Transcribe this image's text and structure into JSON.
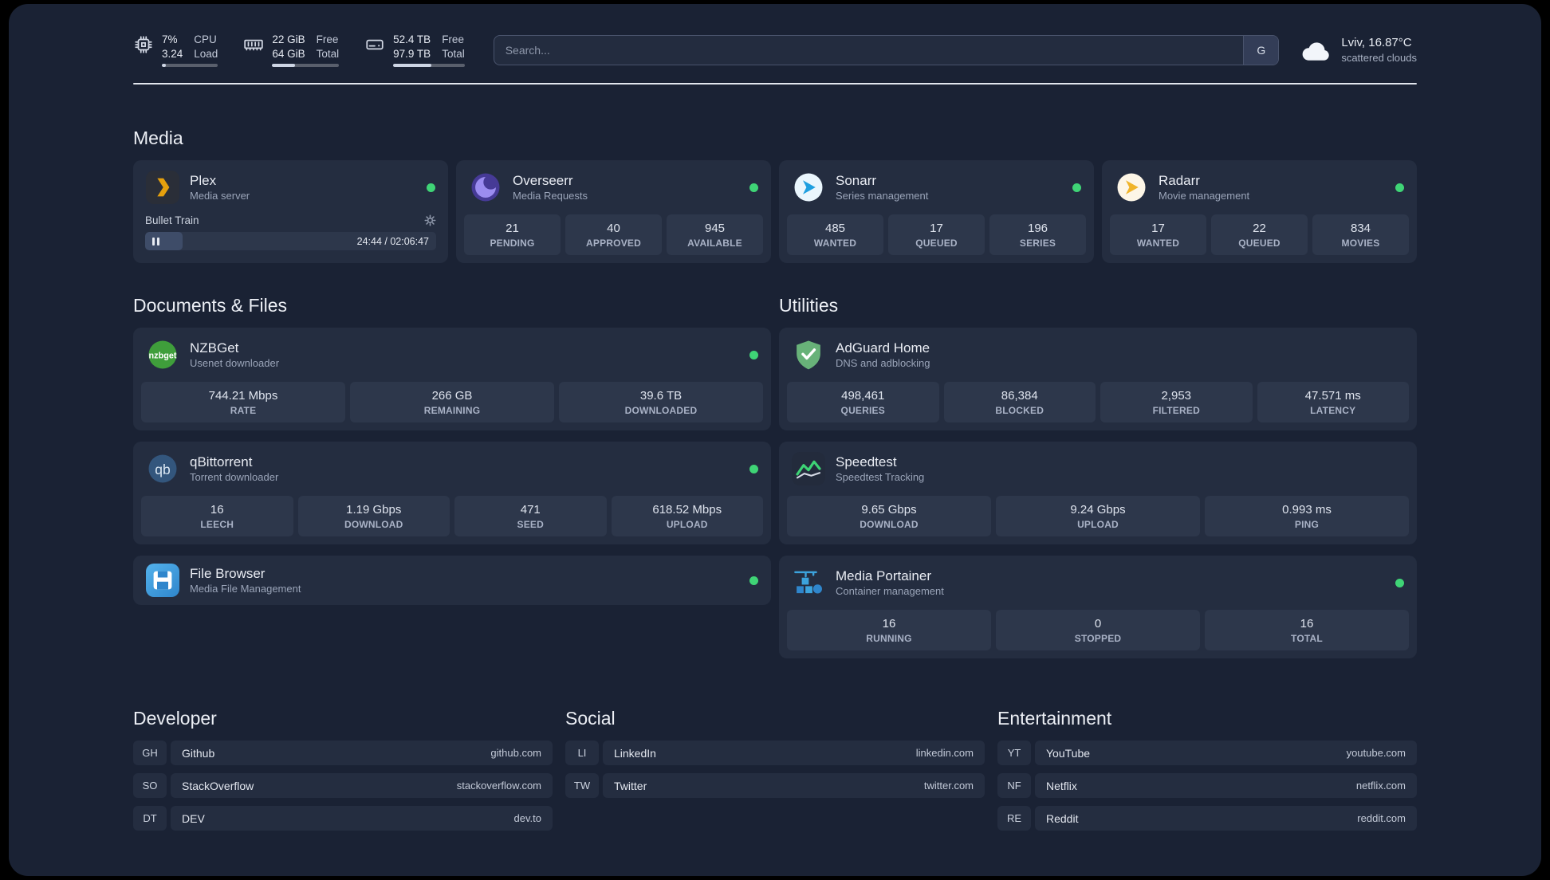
{
  "colors": {
    "status_online": "#3fd476",
    "accent_green": "#3dd375",
    "plex_amber": "#e5a00d",
    "adguard_green": "#68b279",
    "portainer_blue": "#3ca3dd"
  },
  "topbar": {
    "cpu": {
      "v1": "7%",
      "v2": "3.24",
      "l1": "CPU",
      "l2": "Load",
      "pct": 7
    },
    "memory": {
      "v1": "22 GiB",
      "v2": "64 GiB",
      "l1": "Free",
      "l2": "Total",
      "pct": 34
    },
    "disk": {
      "v1": "52.4 TB",
      "v2": "97.9 TB",
      "l1": "Free",
      "l2": "Total",
      "pct": 53
    },
    "search": {
      "placeholder": "Search...",
      "provider": "G"
    },
    "weather": {
      "location": "Lviv, 16.87°C",
      "condition": "scattered clouds"
    }
  },
  "media": {
    "heading": "Media",
    "plex": {
      "name": "Plex",
      "desc": "Media server",
      "player": {
        "title": "Bullet Train",
        "time": "24:44 / 02:06:47",
        "progress": 13
      }
    },
    "overseerr": {
      "name": "Overseerr",
      "desc": "Media Requests",
      "stats": [
        {
          "v": "21",
          "l": "PENDING"
        },
        {
          "v": "40",
          "l": "APPROVED"
        },
        {
          "v": "945",
          "l": "AVAILABLE"
        }
      ]
    },
    "sonarr": {
      "name": "Sonarr",
      "desc": "Series management",
      "stats": [
        {
          "v": "485",
          "l": "WANTED"
        },
        {
          "v": "17",
          "l": "QUEUED"
        },
        {
          "v": "196",
          "l": "SERIES"
        }
      ]
    },
    "radarr": {
      "name": "Radarr",
      "desc": "Movie management",
      "stats": [
        {
          "v": "17",
          "l": "WANTED"
        },
        {
          "v": "22",
          "l": "QUEUED"
        },
        {
          "v": "834",
          "l": "MOVIES"
        }
      ]
    }
  },
  "documents": {
    "heading": "Documents & Files",
    "nzbget": {
      "name": "NZBGet",
      "desc": "Usenet downloader",
      "icon_text": "nzbget",
      "stats": [
        {
          "v": "744.21 Mbps",
          "l": "RATE"
        },
        {
          "v": "266 GB",
          "l": "REMAINING"
        },
        {
          "v": "39.6 TB",
          "l": "DOWNLOADED"
        }
      ]
    },
    "qbittorrent": {
      "name": "qBittorrent",
      "desc": "Torrent downloader",
      "icon_text": "qb",
      "stats": [
        {
          "v": "16",
          "l": "LEECH"
        },
        {
          "v": "1.19 Gbps",
          "l": "DOWNLOAD"
        },
        {
          "v": "471",
          "l": "SEED"
        },
        {
          "v": "618.52 Mbps",
          "l": "UPLOAD"
        }
      ]
    },
    "filebrowser": {
      "name": "File Browser",
      "desc": "Media File Management"
    }
  },
  "utilities": {
    "heading": "Utilities",
    "adguard": {
      "name": "AdGuard Home",
      "desc": "DNS and adblocking",
      "stats": [
        {
          "v": "498,461",
          "l": "QUERIES"
        },
        {
          "v": "86,384",
          "l": "BLOCKED"
        },
        {
          "v": "2,953",
          "l": "FILTERED"
        },
        {
          "v": "47.571 ms",
          "l": "LATENCY"
        }
      ]
    },
    "speedtest": {
      "name": "Speedtest",
      "desc": "Speedtest Tracking",
      "stats": [
        {
          "v": "9.65 Gbps",
          "l": "DOWNLOAD"
        },
        {
          "v": "9.24 Gbps",
          "l": "UPLOAD"
        },
        {
          "v": "0.993 ms",
          "l": "PING"
        }
      ]
    },
    "portainer": {
      "name": "Media Portainer",
      "desc": "Container management",
      "stats": [
        {
          "v": "16",
          "l": "RUNNING"
        },
        {
          "v": "0",
          "l": "STOPPED"
        },
        {
          "v": "16",
          "l": "TOTAL"
        }
      ]
    }
  },
  "bookmarks": {
    "developer": {
      "heading": "Developer",
      "items": [
        {
          "abbr": "GH",
          "name": "Github",
          "url": "github.com"
        },
        {
          "abbr": "SO",
          "name": "StackOverflow",
          "url": "stackoverflow.com"
        },
        {
          "abbr": "DT",
          "name": "DEV",
          "url": "dev.to"
        }
      ]
    },
    "social": {
      "heading": "Social",
      "items": [
        {
          "abbr": "LI",
          "name": "LinkedIn",
          "url": "linkedin.com"
        },
        {
          "abbr": "TW",
          "name": "Twitter",
          "url": "twitter.com"
        }
      ]
    },
    "entertainment": {
      "heading": "Entertainment",
      "items": [
        {
          "abbr": "YT",
          "name": "YouTube",
          "url": "youtube.com"
        },
        {
          "abbr": "NF",
          "name": "Netflix",
          "url": "netflix.com"
        },
        {
          "abbr": "RE",
          "name": "Reddit",
          "url": "reddit.com"
        }
      ]
    }
  }
}
